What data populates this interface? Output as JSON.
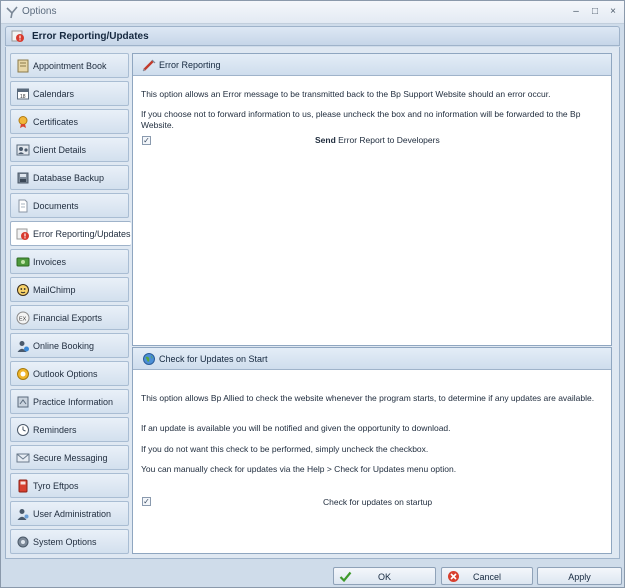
{
  "window": {
    "title": "Options",
    "minimize": "–",
    "maximize": "□",
    "close": "×"
  },
  "header": {
    "title": "Error Reporting/Updates"
  },
  "sidebar": {
    "items": [
      {
        "label": "Appointment Book",
        "icon": "appointment-book-icon"
      },
      {
        "label": "Calendars",
        "icon": "calendar-icon"
      },
      {
        "label": "Certificates",
        "icon": "certificate-icon"
      },
      {
        "label": "Client Details",
        "icon": "client-details-icon"
      },
      {
        "label": "Database Backup",
        "icon": "database-backup-icon"
      },
      {
        "label": "Documents",
        "icon": "documents-icon"
      },
      {
        "label": "Error Reporting/Updates",
        "icon": "error-reporting-icon",
        "active": true
      },
      {
        "label": "Invoices",
        "icon": "invoices-icon"
      },
      {
        "label": "MailChimp",
        "icon": "mailchimp-icon"
      },
      {
        "label": "Financial Exports",
        "icon": "financial-exports-icon"
      },
      {
        "label": "Online Booking",
        "icon": "online-booking-icon"
      },
      {
        "label": "Outlook Options",
        "icon": "outlook-icon"
      },
      {
        "label": "Practice Information",
        "icon": "practice-information-icon"
      },
      {
        "label": "Reminders",
        "icon": "reminders-icon"
      },
      {
        "label": "Secure Messaging",
        "icon": "secure-messaging-icon"
      },
      {
        "label": "Tyro Eftpos",
        "icon": "tyro-eftpos-icon"
      },
      {
        "label": "User Administration",
        "icon": "user-administration-icon"
      },
      {
        "label": "System Options",
        "icon": "system-options-icon"
      }
    ]
  },
  "error_panel": {
    "title": "Error Reporting",
    "text1": "This option allows an Error message to be transmitted back to the Bp Support Website should an error occur.",
    "text2": "If you choose not to forward information to us, please uncheck the box and no information will be forwarded to the Bp Website.",
    "checkbox_bold": "Send",
    "checkbox_rest": " Error Report to Developers",
    "checked": true
  },
  "updates_panel": {
    "title": "Check for Updates on Start",
    "text1": "This option allows Bp Allied to check the website whenever the program starts, to determine if any updates are available.",
    "text2": "If an update is available you will be notified and given the opportunity to download.",
    "text3": "If you do not want this check to be performed, simply uncheck the checkbox.",
    "text4": "You can manually check for updates via the Help > Check for Updates menu option.",
    "checkbox_label": "Check for updates on startup",
    "checked": true
  },
  "buttons": {
    "ok": "OK",
    "cancel": "Cancel",
    "apply": "Apply"
  },
  "colors": {
    "accent": "#cfdcea",
    "panel_border": "#8fa6c0"
  }
}
